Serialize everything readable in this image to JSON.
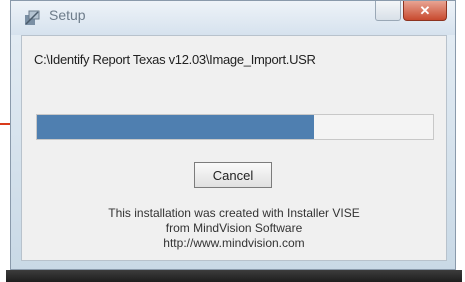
{
  "window": {
    "title": "Setup",
    "icon": "setup-icon",
    "close_glyph": "✕"
  },
  "installer": {
    "path": "C:\\Identify Report Texas v12.03\\Image_Import.USR",
    "progress_percent": 70,
    "cancel_label": "Cancel"
  },
  "footer": {
    "line1": "This installation was created with Installer VISE",
    "line2": "from MindVision Software",
    "line3": "http://www.mindvision.com"
  },
  "colors": {
    "progress_fill": "#4f7fb0",
    "close_button": "#c84a2f",
    "pointer_arrow": "#d93a1a"
  },
  "annotation": {
    "icon": "pointer-arrow-icon"
  }
}
